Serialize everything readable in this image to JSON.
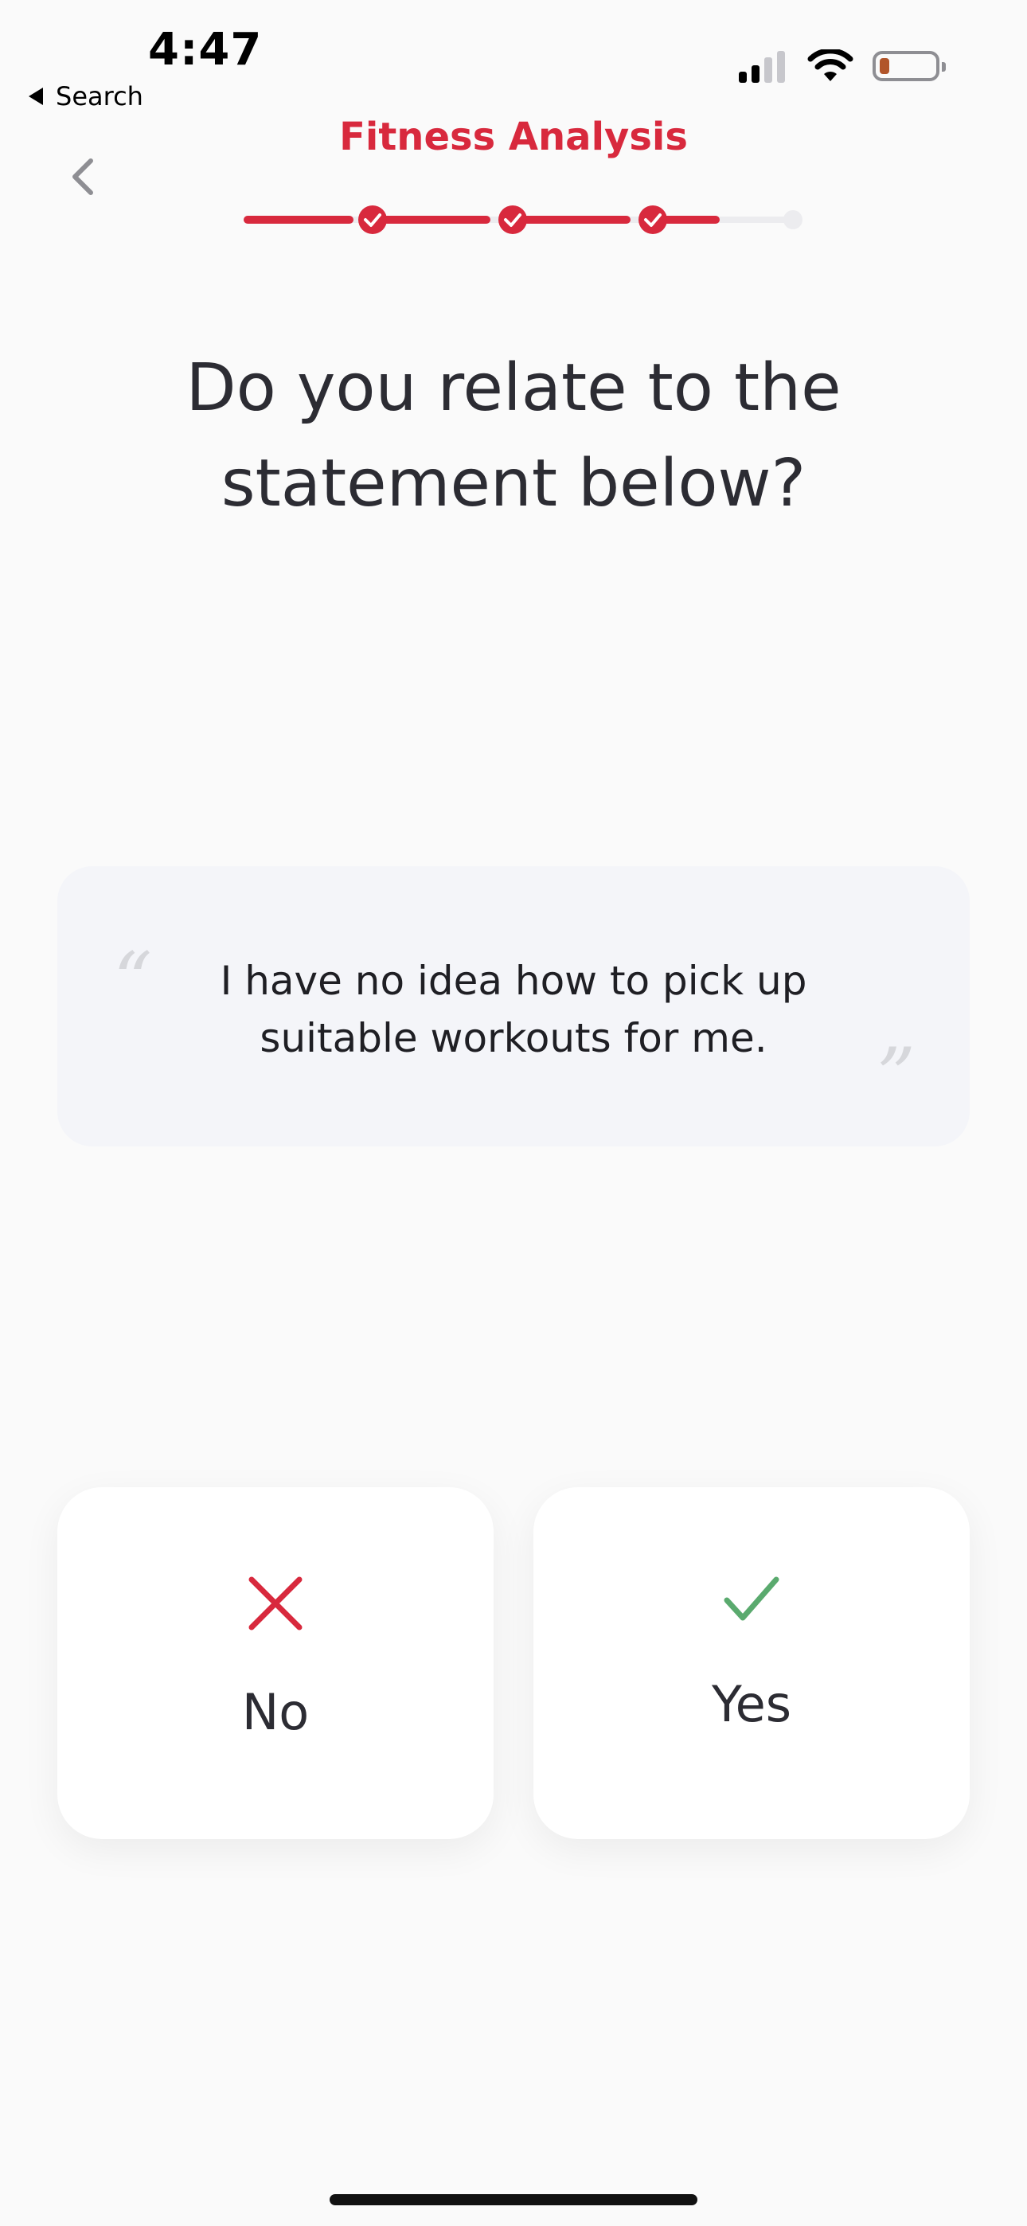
{
  "status_bar": {
    "time": "4:47",
    "back_label": "Search",
    "icons": [
      "signal-icon",
      "wifi-icon",
      "battery-icon"
    ]
  },
  "header": {
    "title": "Fitness Analysis",
    "back_icon": "chevron-left-icon"
  },
  "progress": {
    "steps_total": 4,
    "steps_completed": 3,
    "current_step_fraction": 0.5
  },
  "question": {
    "line1": "Do you relate to the",
    "line2": "statement below?"
  },
  "statement": {
    "text_line1": "I have no idea how to pick up",
    "text_line2": "suitable workouts for me."
  },
  "answers": [
    {
      "label": "No",
      "icon": "close-icon",
      "color": "#d8293d"
    },
    {
      "label": "Yes",
      "icon": "check-icon",
      "color": "#5aaa6e"
    }
  ],
  "colors": {
    "accent": "#d8293d",
    "progress_track": "#ececef",
    "background": "#fafafa"
  }
}
